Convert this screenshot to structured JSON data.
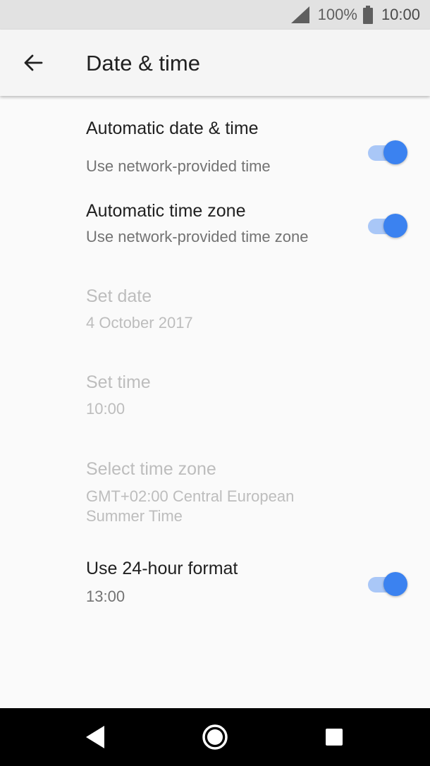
{
  "status_bar": {
    "battery_percent": "100%",
    "time": "10:00",
    "icons": [
      "signal-icon",
      "battery-icon"
    ]
  },
  "app_bar": {
    "title": "Date & time",
    "back_icon": "arrow-back-icon"
  },
  "settings": [
    {
      "title": "Automatic date & time",
      "summary": "Use network-provided time",
      "enabled": true,
      "toggle": true,
      "checked": true
    },
    {
      "title": "Automatic time zone",
      "summary": "Use network-provided time zone",
      "enabled": true,
      "toggle": true,
      "checked": true
    },
    {
      "title": "Set date",
      "summary": "4 October 2017",
      "enabled": false,
      "toggle": false
    },
    {
      "title": "Set time",
      "summary": "10:00",
      "enabled": false,
      "toggle": false
    },
    {
      "title": "Select time zone",
      "summary_line1": "GMT+02:00 Central European",
      "summary_line2": "Summer Time",
      "enabled": false,
      "toggle": false
    },
    {
      "title": "Use 24-hour format",
      "summary": "13:00",
      "enabled": true,
      "toggle": true,
      "checked": true
    }
  ],
  "nav_bar": {
    "icons": [
      "nav-back-icon",
      "nav-home-icon",
      "nav-recents-icon"
    ]
  },
  "colors": {
    "accent": "#3b82f0",
    "accent_track": "#a9c7f7",
    "status_bar_bg": "#e2e2e2",
    "app_bar_bg": "#f5f5f5",
    "background": "#fafafa",
    "disabled_text": "#bdbdbd"
  }
}
